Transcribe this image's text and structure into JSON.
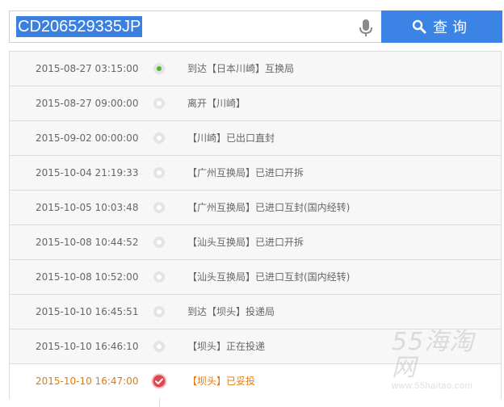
{
  "search": {
    "value": "CD206529335JP",
    "button_label": "查询"
  },
  "events": [
    {
      "time": "2015-08-27 03:15:00",
      "status": "到达【日本川崎】互换局",
      "marker": "green"
    },
    {
      "time": "2015-08-27 09:00:00",
      "status": "离开【川崎】",
      "marker": "gray"
    },
    {
      "time": "2015-09-02 00:00:00",
      "status": "【川崎】已出口直封",
      "marker": "gray"
    },
    {
      "time": "2015-10-04 21:19:33",
      "status": "【广州互换局】已进口开拆",
      "marker": "gray"
    },
    {
      "time": "2015-10-05 10:03:48",
      "status": "【广州互换局】已进口互封(国内经转)",
      "marker": "gray"
    },
    {
      "time": "2015-10-08 10:44:52",
      "status": "【汕头互换局】已进口开拆",
      "marker": "gray"
    },
    {
      "time": "2015-10-08 10:52:00",
      "status": "【汕头互换局】已进口互封(国内经转)",
      "marker": "gray"
    },
    {
      "time": "2015-10-10 16:45:51",
      "status": "到达【坝头】投递局",
      "marker": "gray"
    },
    {
      "time": "2015-10-10 16:46:10",
      "status": "【坝头】正在投递",
      "marker": "gray"
    },
    {
      "time": "2015-10-10 16:47:00",
      "status": "【坝头】已妥投",
      "marker": "delivered"
    }
  ],
  "watermark": {
    "text": "55海淘网",
    "url": "www.55haitao.com"
  },
  "colors": {
    "accent": "#3b84e5",
    "delivered": "#e07b12",
    "start_marker": "#4db82a",
    "check_marker": "#e0474c"
  }
}
